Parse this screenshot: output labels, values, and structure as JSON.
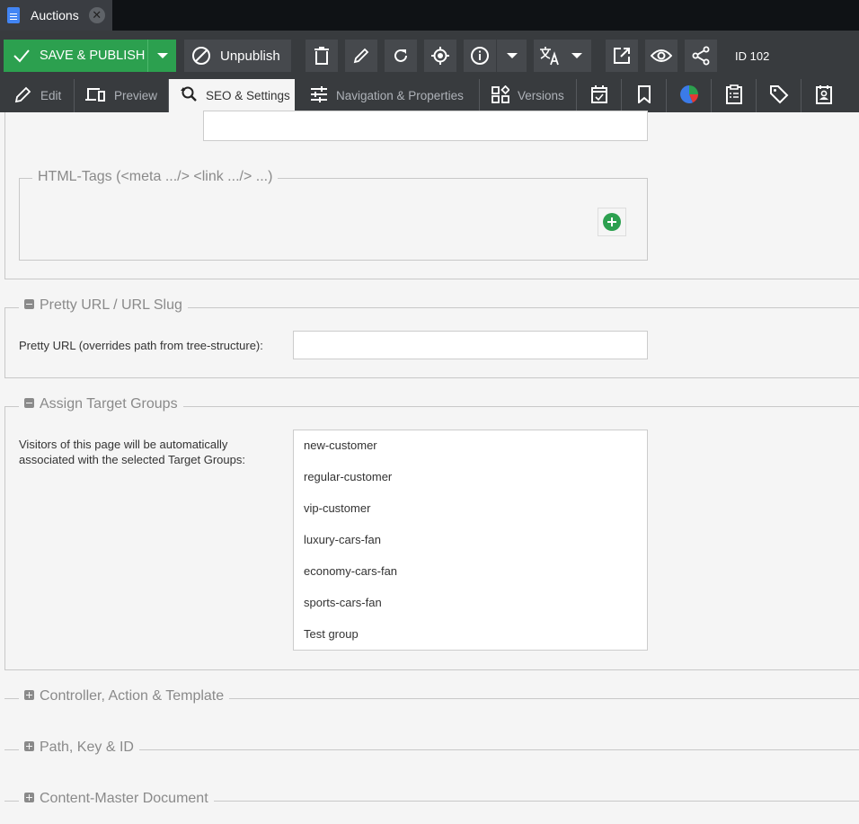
{
  "window": {
    "tab_title": "Auctions",
    "doc_icon": "document-icon",
    "close_icon": "close-icon"
  },
  "toolbar": {
    "save_publish_label": "SAVE & PUBLISH",
    "unpublish_label": "Unpublish",
    "id_label": "ID 102",
    "icons": [
      "check-icon",
      "chevron-down-icon",
      "unpublish-icon",
      "delete-icon",
      "rename-icon",
      "reload-icon",
      "locate-icon",
      "info-icon",
      "chevron-down-icon",
      "translate-icon",
      "chevron-down-icon",
      "open-external-icon",
      "preview-eye-icon",
      "share-icon"
    ]
  },
  "tabs": [
    {
      "label": "Edit",
      "icon": "pencil-icon"
    },
    {
      "label": "Preview",
      "icon": "devices-icon"
    },
    {
      "label": "SEO & Settings",
      "icon": "seo-search-icon",
      "active": true
    },
    {
      "label": "Navigation & Properties",
      "icon": "sliders-icon"
    },
    {
      "label": "Versions",
      "icon": "versions-icon"
    },
    {
      "label": "",
      "icon": "schedule-calendar-icon"
    },
    {
      "label": "",
      "icon": "bookmark-icon"
    },
    {
      "label": "",
      "icon": "pie-chart-icon"
    },
    {
      "label": "",
      "icon": "clipboard-list-icon"
    },
    {
      "label": "",
      "icon": "tag-icon"
    },
    {
      "label": "",
      "icon": "badge-icon"
    }
  ],
  "sections": {
    "html_tags": {
      "legend": "HTML-Tags (<meta .../> <link .../> ...)",
      "add_icon": "add-circle-icon"
    },
    "pretty_url": {
      "legend": "Pretty URL / URL Slug",
      "field_label": "Pretty URL (overrides path from tree-structure):",
      "value": "",
      "expanded": true
    },
    "target_groups": {
      "legend": "Assign Target Groups",
      "field_label": "Visitors of this page will be automatically associated with the selected Target Groups:",
      "options": [
        "new-customer",
        "regular-customer",
        "vip-customer",
        "luxury-cars-fan",
        "economy-cars-fan",
        "sports-cars-fan",
        "Test group"
      ],
      "expanded": true
    },
    "controller": {
      "legend": "Controller, Action & Template",
      "expanded": false
    },
    "path_key": {
      "legend": "Path, Key & ID",
      "expanded": false
    },
    "content_master": {
      "legend": "Content-Master Document",
      "expanded": false
    }
  },
  "colors": {
    "accent_green": "#2ca04f",
    "toolbar_bg": "#383b3e",
    "content_bg": "#f5f5f5"
  }
}
